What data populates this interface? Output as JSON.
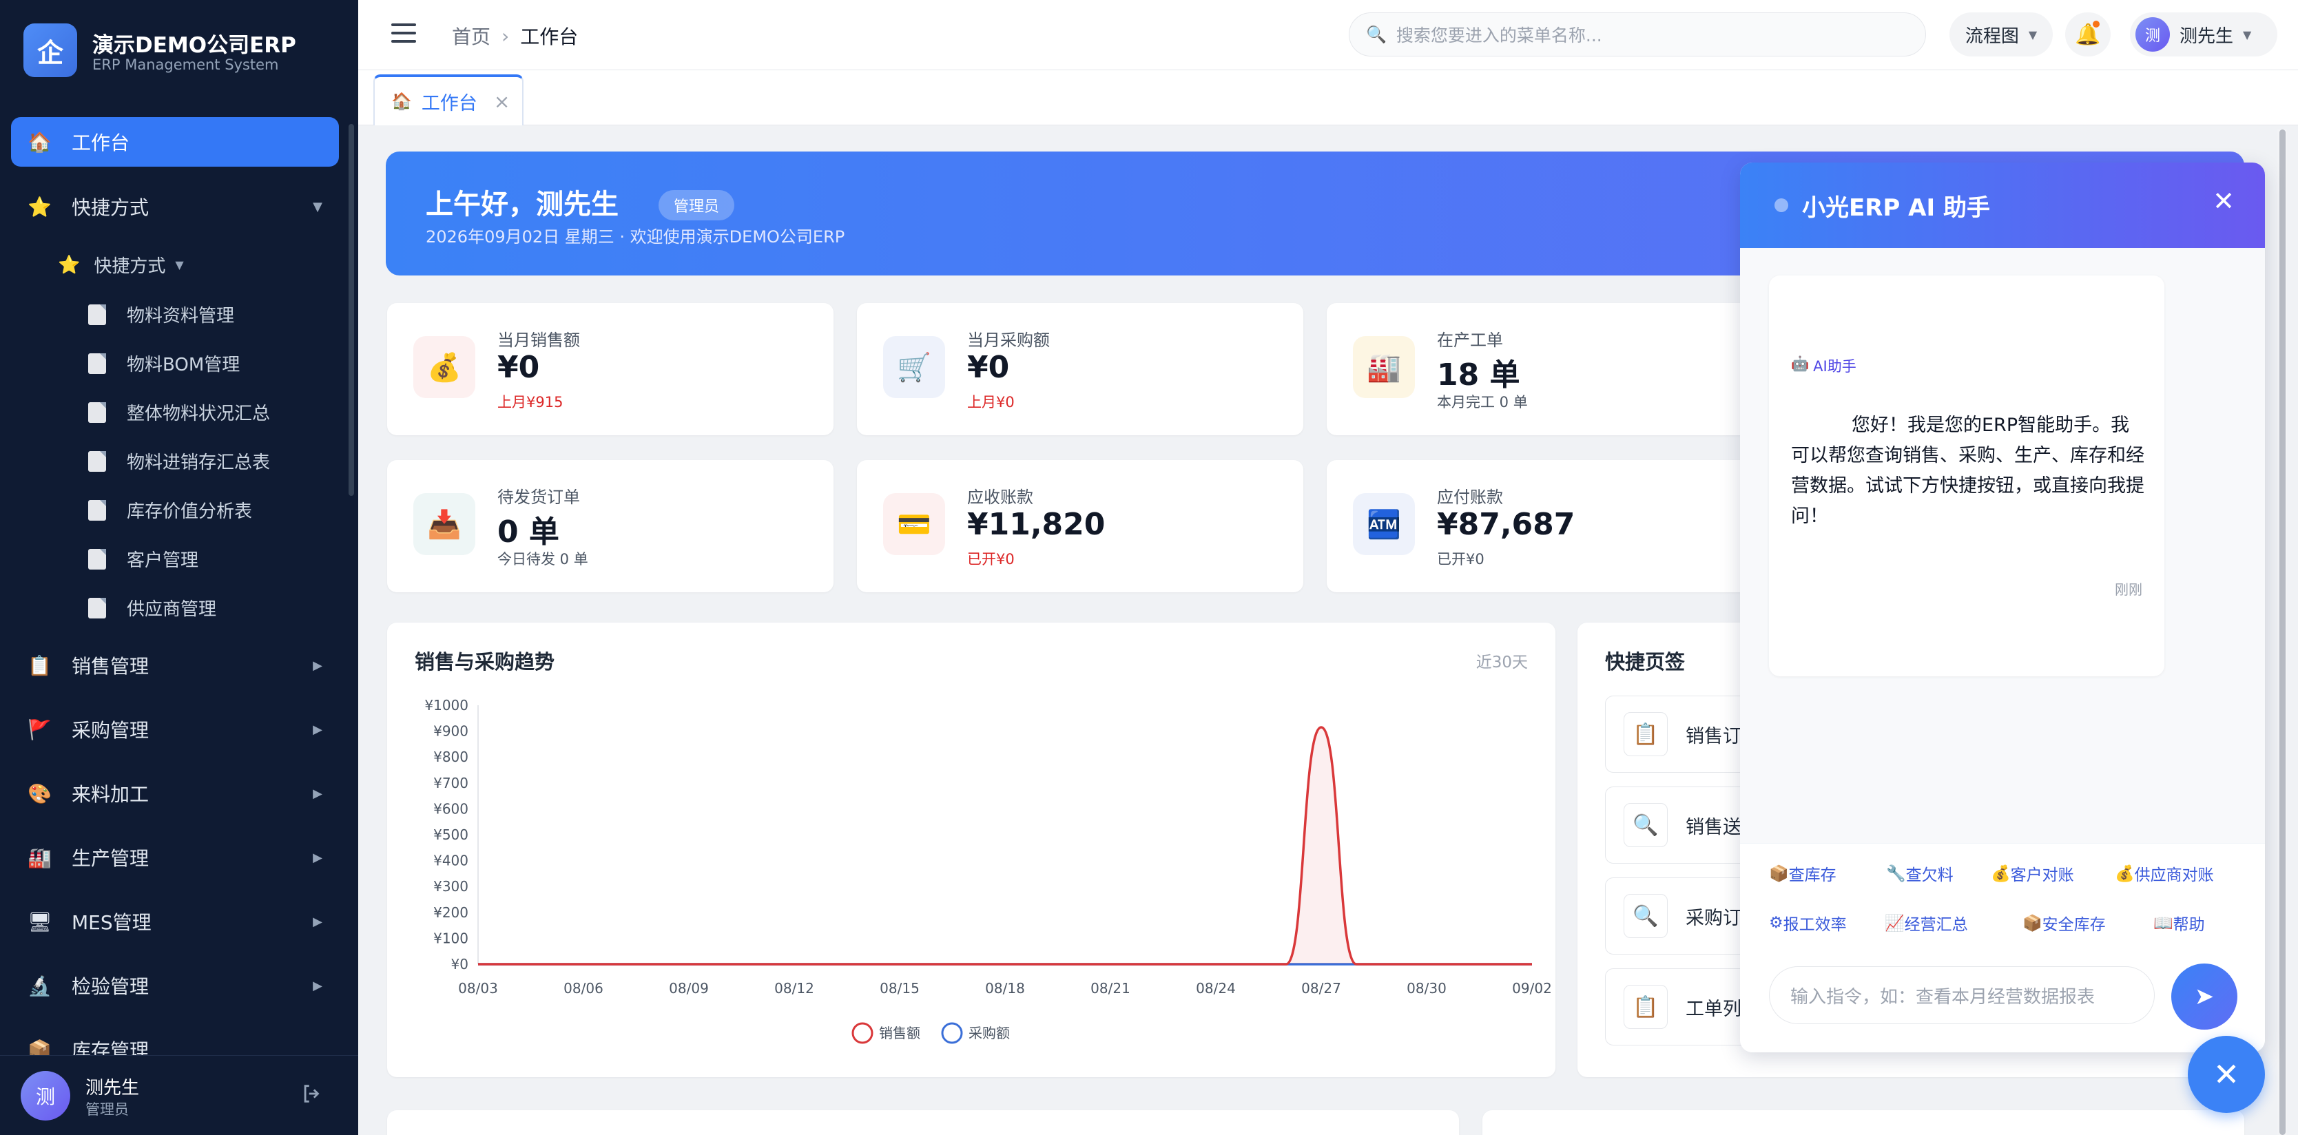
{
  "brand": {
    "logo_char": "企",
    "title": "演示DEMO公司ERP",
    "subtitle": "ERP Management System"
  },
  "sidebar": {
    "workbench": "工作台",
    "shortcut_group": "快捷方式",
    "shortcut_sub": "快捷方式",
    "shortcut_items": [
      "物料资料管理",
      "物料BOM管理",
      "整体物料状况汇总",
      "物料进销存汇总表",
      "库存价值分析表",
      "客户管理",
      "供应商管理"
    ],
    "menus": [
      {
        "icon": "📋",
        "label": "销售管理"
      },
      {
        "icon": "🚩",
        "label": "采购管理"
      },
      {
        "icon": "🎨",
        "label": "来料加工"
      },
      {
        "icon": "🏭",
        "label": "生产管理"
      },
      {
        "icon": "🖥",
        "label": "MES管理"
      },
      {
        "icon": "🔬",
        "label": "检验管理"
      },
      {
        "icon": "📦",
        "label": "库存管理"
      }
    ],
    "user": {
      "avatar_char": "测",
      "name": "测先生",
      "role": "管理员"
    }
  },
  "topbar": {
    "breadcrumb_home": "首页",
    "breadcrumb_sep": "›",
    "breadcrumb_current": "工作台",
    "search_placeholder": "搜索您要进入的菜单名称...",
    "flow_label": "流程图",
    "user_avatar": "测",
    "user_name": "测先生"
  },
  "tabs": [
    {
      "label": "工作台",
      "close": "×"
    }
  ],
  "banner": {
    "greeting": "上午好，测先生",
    "role_badge": "管理员",
    "date_line": "2026年09月02日 星期三 · 欢迎使用演示DEMO公司ERP"
  },
  "stats": [
    {
      "icon": "💰",
      "bg": "#fdf0f0",
      "label": "当月销售额",
      "value": "¥0",
      "sub": "上月¥915",
      "sub_color": "#dc2626"
    },
    {
      "icon": "🛒",
      "bg": "#eef2fb",
      "label": "当月采购额",
      "value": "¥0",
      "sub": "上月¥0",
      "sub_color": "#dc2626"
    },
    {
      "icon": "🏭",
      "bg": "#fdf6e3",
      "label": "在产工单",
      "value": "18 单",
      "sub": "本月完工 0 单",
      "sub_color": "#4b5563"
    },
    {
      "icon": "📥",
      "bg": "#eef6f6",
      "label": "待发货订单",
      "value": "0 单",
      "sub": "今日待发 0 单",
      "sub_color": "#4b5563"
    },
    {
      "icon": "💳",
      "bg": "#fdf0f0",
      "label": "应收账款",
      "value": "¥11,820",
      "sub": "已开¥0",
      "sub_color": "#dc2626"
    },
    {
      "icon": "🏧",
      "bg": "#eef2fb",
      "label": "应付账款",
      "value": "¥87,687",
      "sub": "已开¥0",
      "sub_color": "#4b5563"
    }
  ],
  "trend": {
    "title": "销售与采购趋势",
    "range": "近30天"
  },
  "chart_data": {
    "type": "area",
    "title": "销售与采购趋势",
    "x": [
      "08/03",
      "08/04",
      "08/05",
      "08/06",
      "08/07",
      "08/08",
      "08/09",
      "08/10",
      "08/11",
      "08/12",
      "08/13",
      "08/14",
      "08/15",
      "08/16",
      "08/17",
      "08/18",
      "08/19",
      "08/20",
      "08/21",
      "08/22",
      "08/23",
      "08/24",
      "08/25",
      "08/26",
      "08/27",
      "08/28",
      "08/29",
      "08/30",
      "08/31",
      "09/01",
      "09/02"
    ],
    "tick_labels": [
      "08/03",
      "08/06",
      "08/09",
      "08/12",
      "08/15",
      "08/18",
      "08/21",
      "08/24",
      "08/27",
      "08/30",
      "09/02"
    ],
    "y_ticks": [
      "¥0",
      "¥100",
      "¥200",
      "¥300",
      "¥400",
      "¥500",
      "¥600",
      "¥700",
      "¥800",
      "¥900",
      "¥1000"
    ],
    "ylim": [
      0,
      1000
    ],
    "series": [
      {
        "name": "销售额",
        "color": "#d9383a",
        "values": [
          0,
          0,
          0,
          0,
          0,
          0,
          0,
          0,
          0,
          0,
          0,
          0,
          0,
          0,
          0,
          0,
          0,
          0,
          0,
          0,
          0,
          0,
          0,
          0,
          915,
          0,
          0,
          0,
          0,
          0,
          0
        ]
      },
      {
        "name": "采购额",
        "color": "#3b6fd8",
        "values": [
          0,
          0,
          0,
          0,
          0,
          0,
          0,
          0,
          0,
          0,
          0,
          0,
          0,
          0,
          0,
          0,
          0,
          0,
          0,
          0,
          0,
          0,
          0,
          0,
          0,
          0,
          0,
          0,
          0,
          0,
          0
        ]
      }
    ],
    "legend_position": "bottom"
  },
  "quick": {
    "title": "快捷页签",
    "items": [
      {
        "icon": "📋",
        "label": "销售订"
      },
      {
        "icon": "🔍",
        "label": "销售送"
      },
      {
        "icon": "🔍",
        "label": "采购订"
      },
      {
        "icon": "📋",
        "label": "工单列"
      }
    ]
  },
  "ai": {
    "title": "小光ERP AI 助手",
    "close": "✕",
    "sender": "AI助手",
    "message": "您好！我是您的ERP智能助手。我可以帮您查询销售、采购、生产、库存和经营数据。试试下方快捷按钮，或直接向我提问！",
    "time": "刚刚",
    "chips": [
      {
        "icon": "📦",
        "label": "查库存"
      },
      {
        "icon": "🔧",
        "label": "查欠料"
      },
      {
        "icon": "💰",
        "label": "客户对账"
      },
      {
        "icon": "💰",
        "label": "供应商对账"
      },
      {
        "icon": "⚙",
        "label": "报工效率"
      },
      {
        "icon": "📈",
        "label": "经营汇总"
      },
      {
        "icon": "📦",
        "label": "安全库存"
      },
      {
        "icon": "📖",
        "label": "帮助"
      }
    ],
    "input_placeholder": "输入指令，如：查看本月经营数据报表",
    "send": "➤"
  },
  "fab": {
    "icon": "✕"
  }
}
